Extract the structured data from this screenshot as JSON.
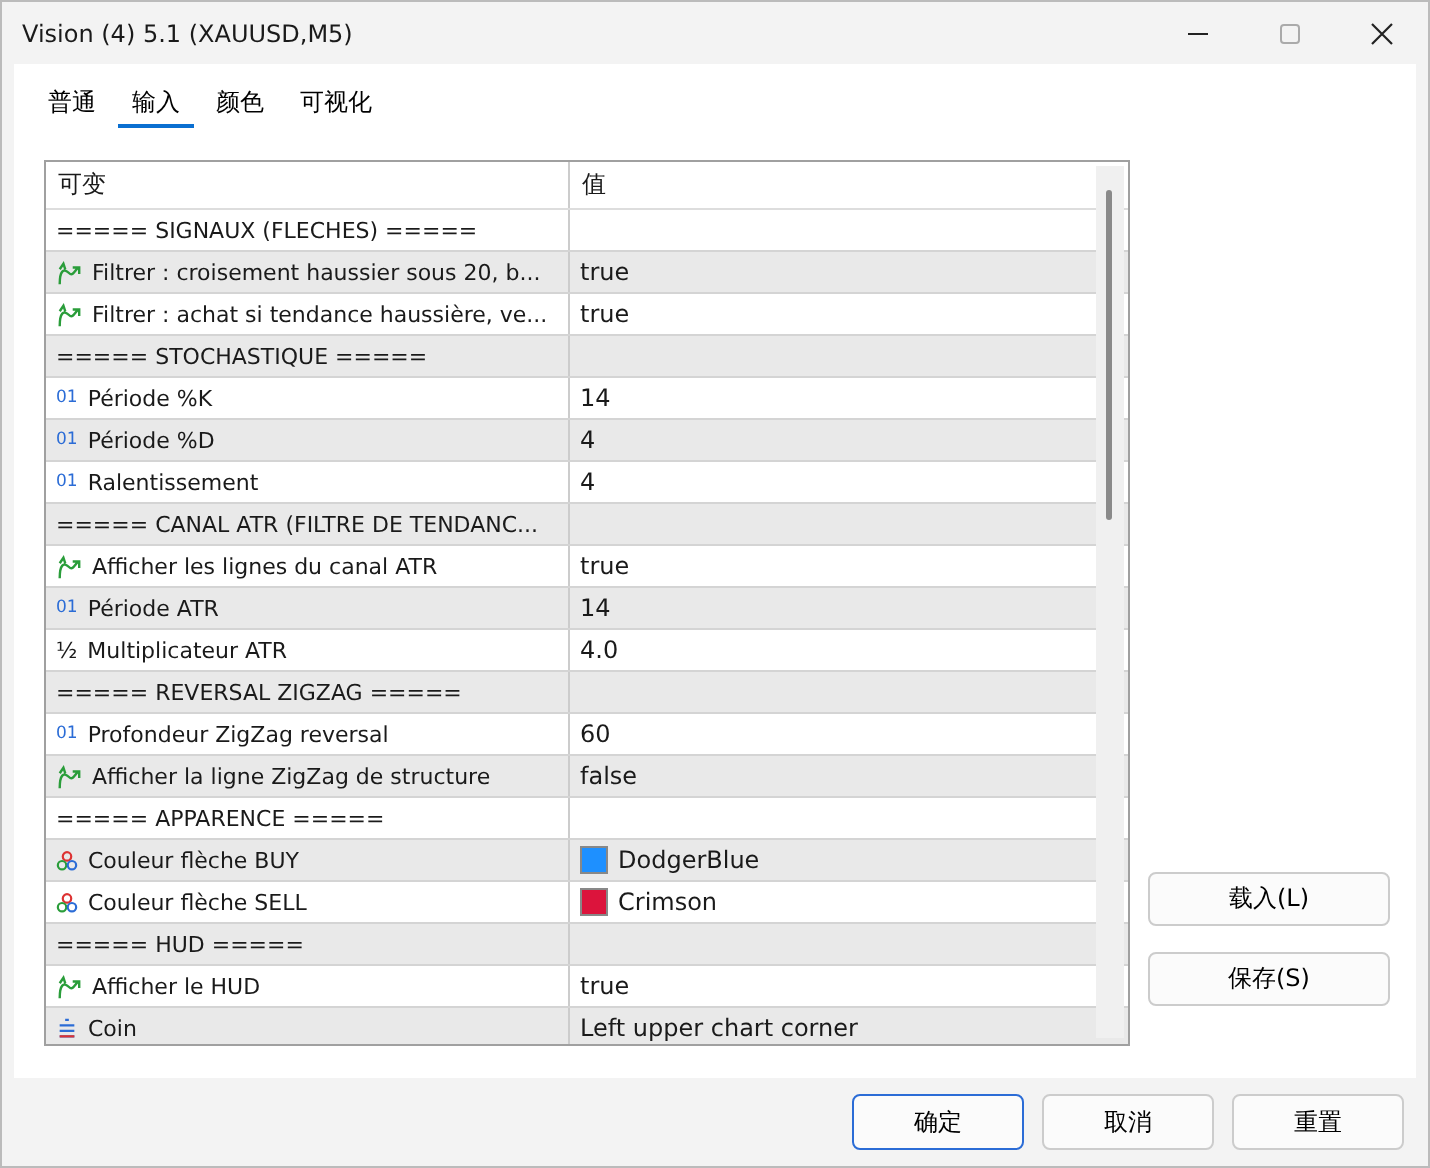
{
  "window": {
    "title": "Vision (4) 5.1 (XAUUSD,M5)"
  },
  "tabs": [
    {
      "label": "普通",
      "selected": false
    },
    {
      "label": "输入",
      "selected": true
    },
    {
      "label": "颜色",
      "selected": false
    },
    {
      "label": "可视化",
      "selected": false
    }
  ],
  "table": {
    "columns": [
      "可变",
      "值"
    ],
    "rows": [
      {
        "kind": "section",
        "name": "===== SIGNAUX (FLECHES) ====="
      },
      {
        "kind": "bool",
        "name": "Filtrer : croisement haussier sous 20, b...",
        "value": "true"
      },
      {
        "kind": "bool",
        "name": "Filtrer : achat si tendance haussière, ve...",
        "value": "true"
      },
      {
        "kind": "section",
        "name": "===== STOCHASTIQUE ====="
      },
      {
        "kind": "int",
        "icon": "01",
        "name": "Période %K",
        "value": "14"
      },
      {
        "kind": "int",
        "icon": "01",
        "name": "Période %D",
        "value": "4"
      },
      {
        "kind": "int",
        "icon": "01",
        "name": "Ralentissement",
        "value": "4"
      },
      {
        "kind": "section",
        "name": "===== CANAL ATR (FILTRE DE TENDANC..."
      },
      {
        "kind": "bool",
        "name": "Afficher les lignes du canal ATR",
        "value": "true"
      },
      {
        "kind": "int",
        "icon": "01",
        "name": "Période ATR",
        "value": "14"
      },
      {
        "kind": "double",
        "icon": "½",
        "name": "Multiplicateur ATR",
        "value": "4.0"
      },
      {
        "kind": "section",
        "name": "===== REVERSAL ZIGZAG ====="
      },
      {
        "kind": "int",
        "icon": "01",
        "name": "Profondeur ZigZag reversal",
        "value": "60"
      },
      {
        "kind": "bool",
        "name": "Afficher la ligne ZigZag de structure",
        "value": "false"
      },
      {
        "kind": "section",
        "name": "===== APPARENCE ====="
      },
      {
        "kind": "color",
        "name": "Couleur flèche BUY",
        "value": "DodgerBlue",
        "color": "#1e90ff"
      },
      {
        "kind": "color",
        "name": "Couleur flèche SELL",
        "value": "Crimson",
        "color": "#dc143c"
      },
      {
        "kind": "section",
        "name": "===== HUD ====="
      },
      {
        "kind": "bool",
        "name": "Afficher le HUD",
        "value": "true"
      },
      {
        "kind": "enum",
        "name": "Coin",
        "value": "Left upper chart corner"
      }
    ]
  },
  "side_buttons": [
    "载入(L)",
    "保存(S)"
  ],
  "footer_buttons": [
    {
      "label": "确定",
      "selected": true
    },
    {
      "label": "取消",
      "selected": false
    },
    {
      "label": "重置",
      "selected": false
    }
  ]
}
